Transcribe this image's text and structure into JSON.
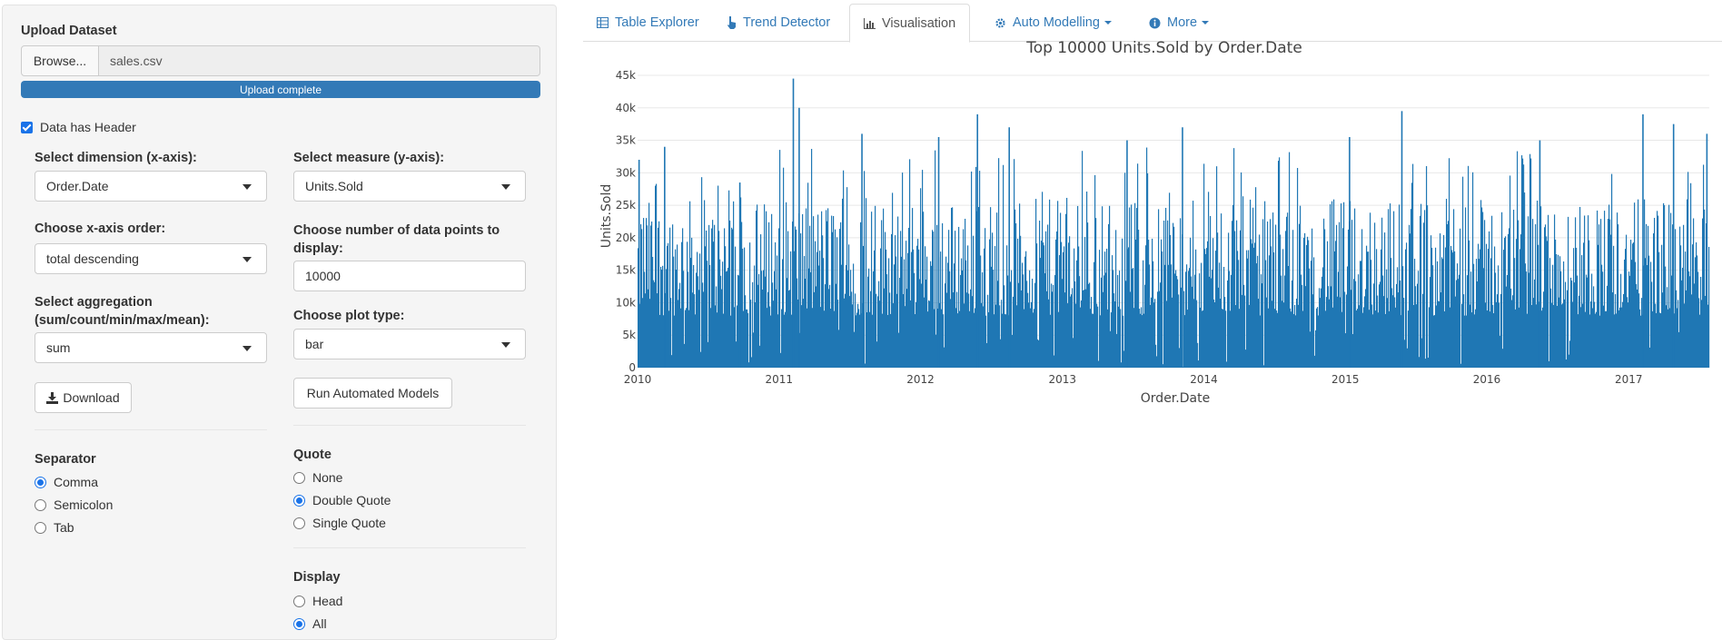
{
  "upload": {
    "title": "Upload Dataset",
    "browse_label": "Browse...",
    "file_name": "sales.csv",
    "progress_text": "Upload complete",
    "progress_fraction": 1.0,
    "header_checkbox_label": "Data has Header",
    "header_checked": true
  },
  "controls": {
    "dimension_label": "Select dimension (x-axis):",
    "dimension_value": "Order.Date",
    "measure_label": "Select measure (y-axis):",
    "measure_value": "Units.Sold",
    "xorder_label": "Choose x-axis order:",
    "xorder_value": "total descending",
    "npoints_label_1": "Choose number of data points to",
    "npoints_label_2": "display:",
    "npoints_value": "10000",
    "aggregation_label_1": "Select aggregation",
    "aggregation_label_2": "(sum/count/min/max/mean):",
    "aggregation_value": "sum",
    "plottype_label": "Choose plot type:",
    "plottype_value": "bar",
    "download_label": "Download",
    "run_models_label": "Run Automated Models"
  },
  "separator": {
    "label": "Separator",
    "options": [
      "Comma",
      "Semicolon",
      "Tab"
    ],
    "selected": "Comma"
  },
  "quote": {
    "label": "Quote",
    "options": [
      "None",
      "Double Quote",
      "Single Quote"
    ],
    "selected": "Double Quote"
  },
  "display": {
    "label": "Display",
    "options": [
      "Head",
      "All"
    ],
    "selected": "All"
  },
  "tabs": [
    {
      "label": "Table Explorer",
      "icon": "table-icon",
      "active": false
    },
    {
      "label": "Trend Detector",
      "icon": "hand-pointer-icon",
      "active": false
    },
    {
      "label": "Visualisation",
      "icon": "chart-icon",
      "active": true
    },
    {
      "label": "Auto Modelling",
      "icon": "gear-icon",
      "active": false,
      "dropdown": true
    },
    {
      "label": "More",
      "icon": "info-icon",
      "active": false,
      "dropdown": true
    }
  ],
  "chart_data": {
    "type": "bar",
    "title": "Top 10000 Units.Sold by Order.Date",
    "xlabel": "Order.Date",
    "ylabel": "Units.Sold",
    "xlim": [
      "2010-01-01",
      "2017-07-28"
    ],
    "x_ticks": [
      "2010",
      "2011",
      "2012",
      "2013",
      "2014",
      "2015",
      "2016",
      "2017"
    ],
    "ylim": [
      0,
      45000
    ],
    "y_ticks": [
      "0",
      "5k",
      "10k",
      "15k",
      "20k",
      "25k",
      "30k",
      "35k",
      "40k",
      "45k"
    ],
    "color": "#1f77b4",
    "grid": "horizontal",
    "peaks": [
      {
        "x": "2010-01-03",
        "y": 32000
      },
      {
        "x": "2010-03-10",
        "y": 34000
      },
      {
        "x": "2010-09-20",
        "y": 28500
      },
      {
        "x": "2011-02-05",
        "y": 44500
      },
      {
        "x": "2011-02-20",
        "y": 40000
      },
      {
        "x": "2011-08-01",
        "y": 36000
      },
      {
        "x": "2012-02-15",
        "y": 35500
      },
      {
        "x": "2012-05-25",
        "y": 39000
      },
      {
        "x": "2012-08-15",
        "y": 37000
      },
      {
        "x": "2013-06-15",
        "y": 35000
      },
      {
        "x": "2013-11-05",
        "y": 37000
      },
      {
        "x": "2015-01-10",
        "y": 35500
      },
      {
        "x": "2015-05-25",
        "y": 39500
      },
      {
        "x": "2016-05-15",
        "y": 35000
      },
      {
        "x": "2017-02-05",
        "y": 39000
      },
      {
        "x": "2017-04-25",
        "y": 37500
      },
      {
        "x": "2017-07-20",
        "y": 36000
      }
    ],
    "typical_range": [
      8000,
      26000
    ]
  },
  "colors": {
    "accent": "#337ab7",
    "bar": "#1f77b4",
    "radio_checked": "#1a73e8"
  }
}
